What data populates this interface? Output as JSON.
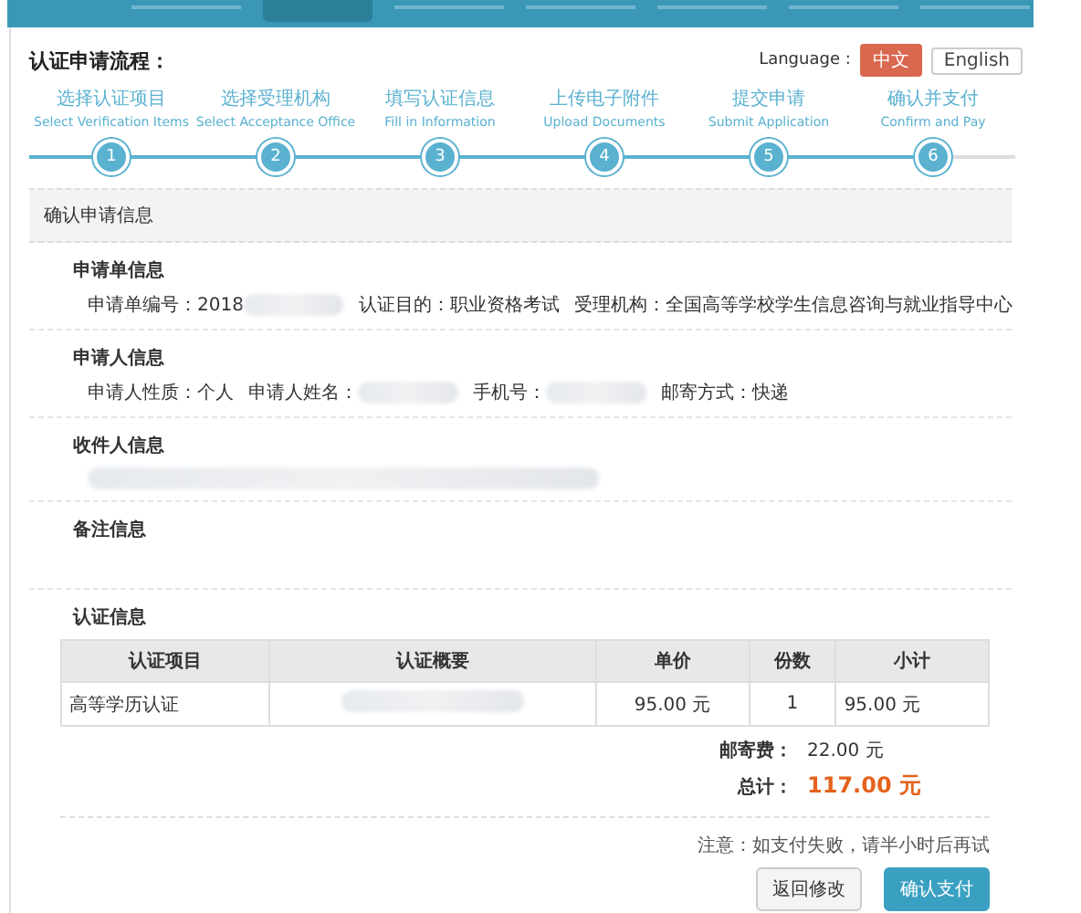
{
  "nav_bar": {
    "tabs": [
      {
        "selected": false
      },
      {
        "selected": true
      },
      {
        "selected": false
      },
      {
        "selected": false
      },
      {
        "selected": false
      },
      {
        "selected": false
      },
      {
        "selected": false
      }
    ]
  },
  "process": {
    "title": "认证申请流程：",
    "language_label": "Language :",
    "languages": [
      {
        "label": "中文",
        "selected": true
      },
      {
        "label": "English",
        "selected": false
      }
    ],
    "steps": [
      {
        "zh": "选择认证项目",
        "en": "Select Verification Items",
        "number": "1",
        "done": true
      },
      {
        "zh": "选择受理机构",
        "en": "Select Acceptance Office",
        "number": "2",
        "done": true
      },
      {
        "zh": "填写认证信息",
        "en": "Fill in Information",
        "number": "3",
        "done": true
      },
      {
        "zh": "上传电子附件",
        "en": "Upload Documents",
        "number": "4",
        "done": true
      },
      {
        "zh": "提交申请",
        "en": "Submit Application",
        "number": "5",
        "done": true
      },
      {
        "zh": "确认并支付",
        "en": "Confirm and Pay",
        "number": "6",
        "done": true
      }
    ]
  },
  "panel_title": "确认申请信息",
  "sections": [
    {
      "title": "申请单信息",
      "fields": [
        {
          "text": "申请单编号：2018",
          "redacted": true
        },
        {
          "text": "认证目的：职业资格考试",
          "redacted": false
        },
        {
          "text": "受理机构：全国高等学校学生信息咨询与就业指导中心",
          "redacted": false
        }
      ]
    },
    {
      "title": "申请人信息",
      "fields": [
        {
          "text": "申请人性质：个人",
          "redacted": false
        },
        {
          "text": "申请人姓名：",
          "redacted": true
        },
        {
          "text": "手机号：",
          "redacted": true
        },
        {
          "text": "邮寄方式：快递",
          "redacted": false
        }
      ]
    },
    {
      "title": "收件人信息",
      "redacted": true
    },
    {
      "title": "备注信息"
    }
  ],
  "verification": {
    "title": "认证信息",
    "columns": [
      "认证项目",
      "认证概要",
      "单价",
      "份数",
      "小计"
    ],
    "rows": [
      {
        "item": "高等学历认证",
        "summary_redacted": true,
        "price": "95.00 元",
        "count": "1",
        "subtotal": "95.00 元"
      }
    ],
    "postage_label": "邮寄费：",
    "postage": "22.00 元",
    "total_label": "总计：",
    "total": "117.00 元"
  },
  "notice": "注意：如支付失败，请半小时后再试",
  "buttons": [
    {
      "label": "返回修改",
      "kind": "secondary"
    },
    {
      "label": "确认支付",
      "kind": "primary"
    }
  ]
}
